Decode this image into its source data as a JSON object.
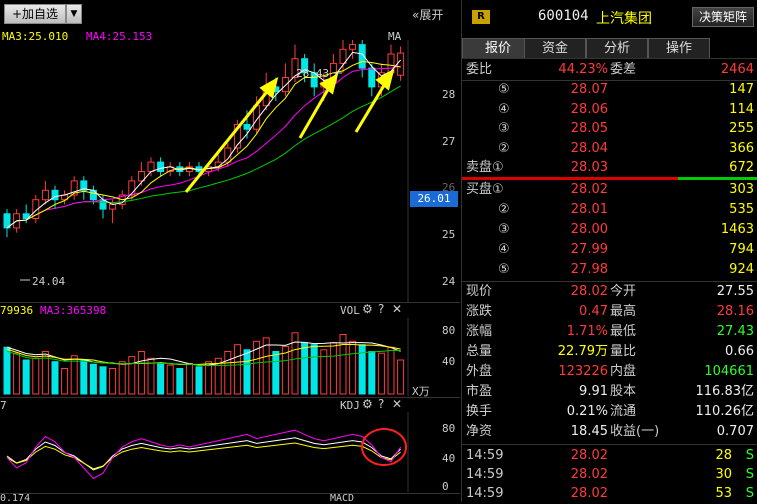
{
  "toolbar": {
    "add_watchlist_label": "+加自选",
    "expand_label": "展开"
  },
  "price_panel": {
    "ma3_label": "MA3:25.010",
    "ma4_label": "MA4:25.153",
    "ma_label": "MA",
    "high_annotation": "28.43",
    "low_annotation": "24.04",
    "y_ticks": [
      "28",
      "27",
      "26",
      "25",
      "24"
    ],
    "current_price_tag": "26.01"
  },
  "volume_panel": {
    "left_value": "79936",
    "ma3_label": "MA3:365398",
    "name": "VOL",
    "y_ticks": [
      "80",
      "40"
    ],
    "unit": "X万"
  },
  "kdj_panel": {
    "left_value": "7",
    "name": "KDJ",
    "y_ticks": [
      "80",
      "40",
      "0"
    ]
  },
  "macd_panel": {
    "left_value": "0.174",
    "name": "MACD"
  },
  "header": {
    "badge": "R",
    "stock_code": "600104",
    "stock_name": "上汽集团",
    "decision_button": "决策矩阵"
  },
  "tabs": [
    "报价",
    "资金",
    "分析",
    "操作"
  ],
  "order_book": {
    "ratio_label": "委比",
    "ratio_value": "44.23%",
    "diff_label": "委差",
    "diff_value": "2464",
    "sell": [
      {
        "label": "⑤",
        "price": "28.07",
        "vol": "147"
      },
      {
        "label": "④",
        "price": "28.06",
        "vol": "114"
      },
      {
        "label": "③",
        "price": "28.05",
        "vol": "255"
      },
      {
        "label": "②",
        "price": "28.04",
        "vol": "366"
      },
      {
        "label": "卖盘①",
        "price": "28.03",
        "vol": "672"
      }
    ],
    "buy": [
      {
        "label": "买盘①",
        "price": "28.02",
        "vol": "303"
      },
      {
        "label": "②",
        "price": "28.01",
        "vol": "535"
      },
      {
        "label": "③",
        "price": "28.00",
        "vol": "1463"
      },
      {
        "label": "④",
        "price": "27.99",
        "vol": "794"
      },
      {
        "label": "⑤",
        "price": "27.98",
        "vol": "924"
      }
    ]
  },
  "quote": [
    {
      "l1": "现价",
      "v1": "28.02",
      "c1": "red",
      "l2": "今开",
      "v2": "27.55",
      "c2": "white"
    },
    {
      "l1": "涨跌",
      "v1": "0.47",
      "c1": "red",
      "l2": "最高",
      "v2": "28.16",
      "c2": "red"
    },
    {
      "l1": "涨幅",
      "v1": "1.71%",
      "c1": "red",
      "l2": "最低",
      "v2": "27.43",
      "c2": "green"
    },
    {
      "l1": "总量",
      "v1": "22.79万",
      "c1": "yellow",
      "l2": "量比",
      "v2": "0.66",
      "c2": "white"
    },
    {
      "l1": "外盘",
      "v1": "123226",
      "c1": "red",
      "l2": "内盘",
      "v2": "104661",
      "c2": "green"
    },
    {
      "l1": "市盈",
      "v1": "9.91",
      "c1": "white",
      "l2": "股本",
      "v2": "116.83亿",
      "c2": "white"
    },
    {
      "l1": "换手",
      "v1": "0.21%",
      "c1": "white",
      "l2": "流通",
      "v2": "110.26亿",
      "c2": "white"
    },
    {
      "l1": "净资",
      "v1": "18.45",
      "c1": "white",
      "l2": "收益(一)",
      "v2": "0.707",
      "c2": "white"
    }
  ],
  "ticks": [
    {
      "time": "14:59",
      "price": "28.02",
      "vol": "28",
      "side": "S"
    },
    {
      "time": "14:59",
      "price": "28.02",
      "vol": "30",
      "side": "S"
    },
    {
      "time": "14:59",
      "price": "28.02",
      "vol": "53",
      "side": "S"
    }
  ],
  "colors": {
    "up": "#ff3b3b",
    "down": "#00e5e5",
    "ma_white": "#ffffff",
    "ma_yellow": "#ffff00",
    "ma_magenta": "#ff00ff",
    "ma_green": "#00cc00",
    "arrow": "#ffff00",
    "circle": "#ff2020"
  }
}
